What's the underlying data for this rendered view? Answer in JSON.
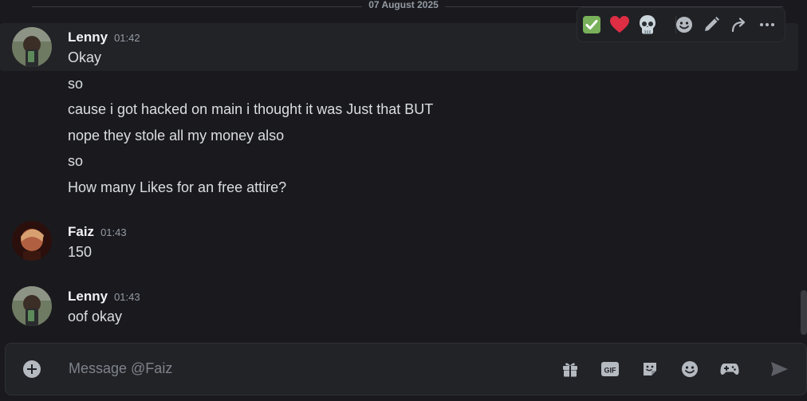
{
  "date_divider": "07 August 2025",
  "messages": [
    {
      "author": "Lenny",
      "time": "01:42",
      "lines": [
        "Okay",
        "so",
        "cause i got hacked on main i thought it was Just that BUT",
        "nope they stole all my money also",
        "so",
        "How many Likes for an free attire?"
      ]
    },
    {
      "author": "Faiz",
      "time": "01:43",
      "lines": [
        "150"
      ]
    },
    {
      "author": "Lenny",
      "time": "01:43",
      "lines": [
        "oof okay"
      ]
    }
  ],
  "toolbar": {
    "reactions": [
      {
        "icon": "check-mark-emoji",
        "color": "#78b159"
      },
      {
        "icon": "red-heart-emoji",
        "color": "#dd2e44"
      },
      {
        "icon": "skull-emoji",
        "color": "#ccd6dd"
      }
    ],
    "actions": [
      "add-reaction-icon",
      "edit-icon",
      "forward-icon",
      "more-icon"
    ]
  },
  "composer": {
    "placeholder": "Message @Faiz",
    "gif_label": "GIF",
    "buttons": [
      "plus-icon",
      "gift-icon",
      "gif-icon",
      "sticker-icon",
      "emoji-icon",
      "apps-icon",
      "send-icon"
    ]
  },
  "colors": {
    "background": "#1a1a1e",
    "hover": "#222327",
    "text": "#dbdee1",
    "muted": "#949ba4"
  }
}
